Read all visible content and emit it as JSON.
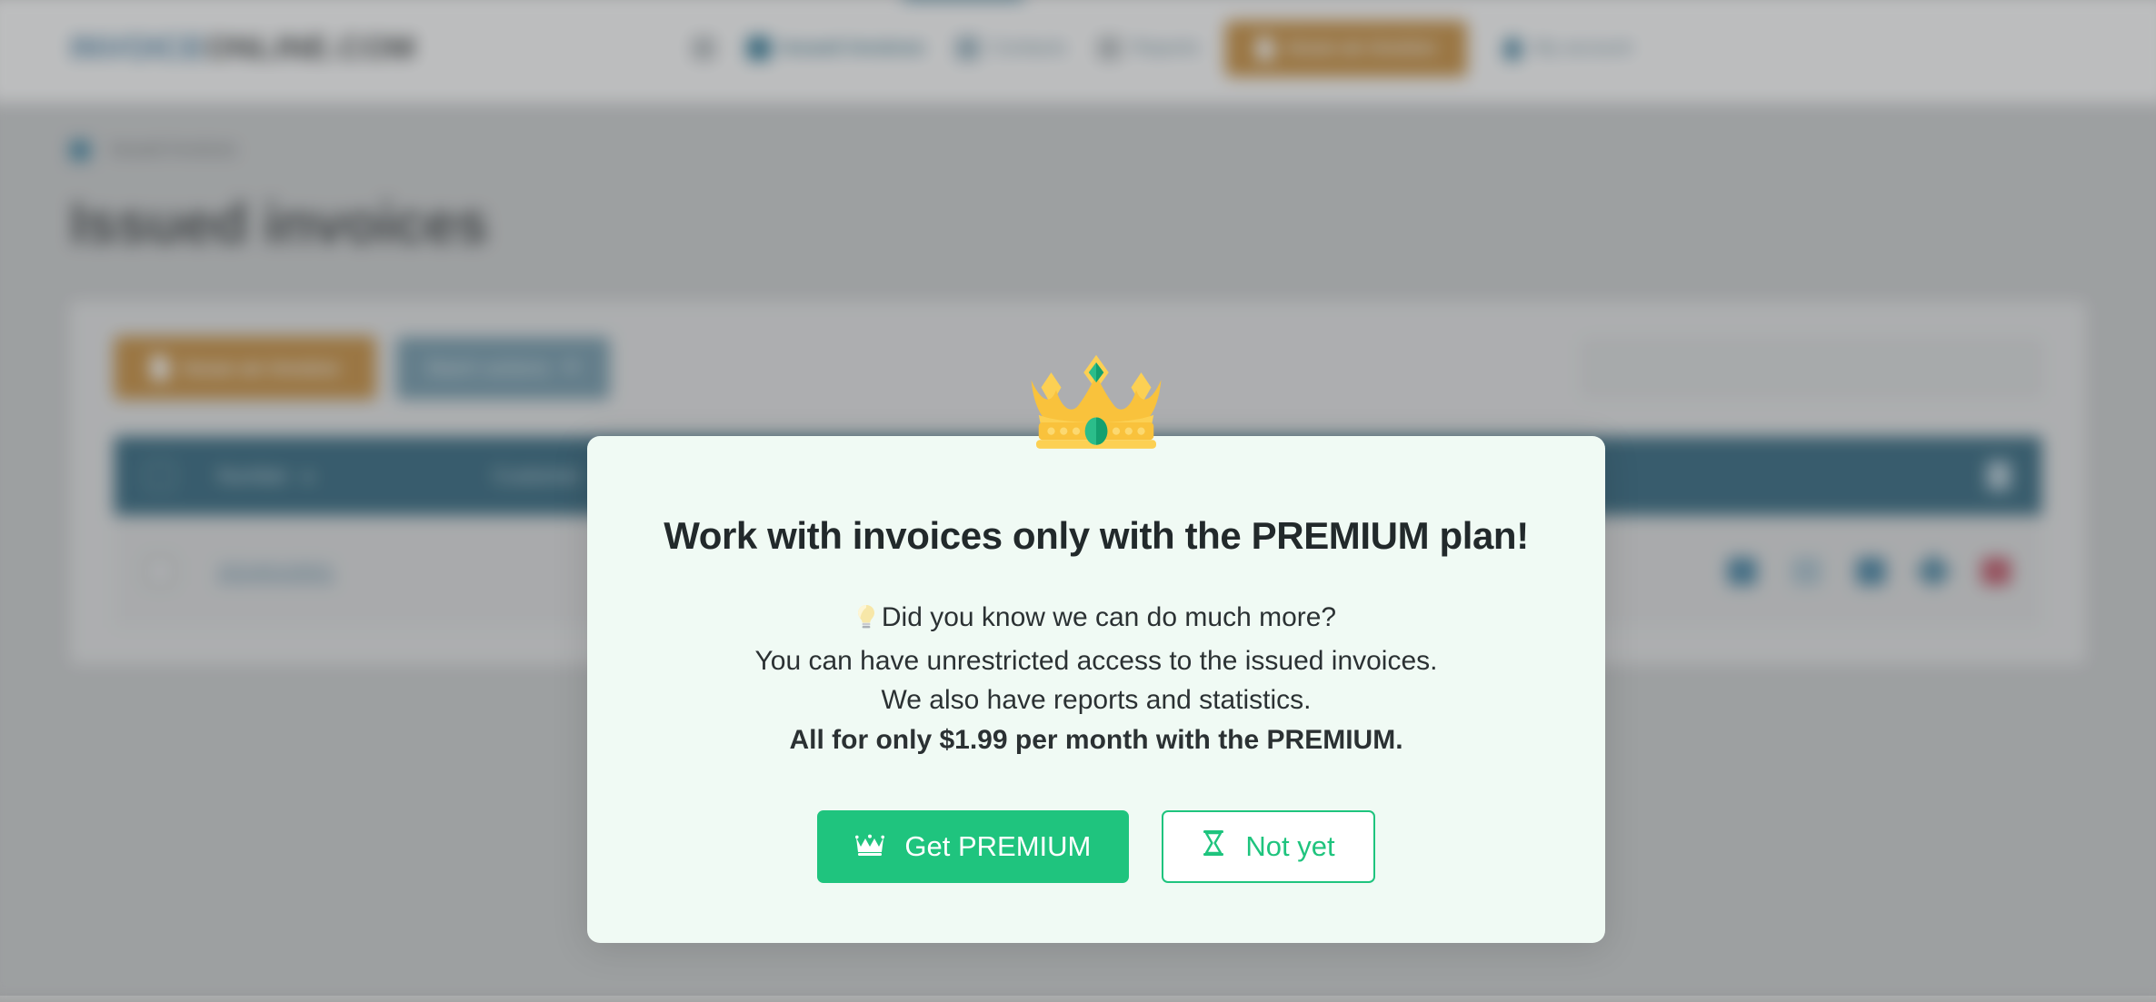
{
  "header": {
    "logo_part_a": "INVOICE",
    "logo_part_b": "ONLINE.COM",
    "nav": [
      {
        "label": "",
        "icon": "search-icon"
      },
      {
        "label": "Issued invoices",
        "icon": "invoice-icon"
      },
      {
        "label": "Contacts",
        "icon": "contacts-icon"
      },
      {
        "label": "Reports",
        "icon": "reports-icon"
      }
    ],
    "issue_button": "Issue an invoice",
    "account_label": "My account"
  },
  "breadcrumb": {
    "home_icon": "home-icon",
    "current": "Issued invoices"
  },
  "page": {
    "title": "Issued invoices"
  },
  "toolbar": {
    "issue_button": "Issue an invoice",
    "batch_button": "Batch actions",
    "search_placeholder": "",
    "search_value": ""
  },
  "table": {
    "columns": [
      "Number",
      "Customer"
    ],
    "rows": [
      {
        "number": "2024010001"
      }
    ],
    "row_action_icons": [
      "preview-icon",
      "download-icon",
      "copy-icon",
      "edit-icon",
      "delete-icon"
    ],
    "settings_icon": "columns-settings-icon"
  },
  "modal": {
    "crown_icon": "crown-icon",
    "title": "Work with invoices only with the PREMIUM plan!",
    "lines": [
      {
        "text": "Did you know we can do much more?",
        "bold": false,
        "bulb": true
      },
      {
        "text": "You can have unrestricted access to the issued invoices.",
        "bold": false,
        "bulb": false
      },
      {
        "text": "We also have reports and statistics.",
        "bold": false,
        "bulb": false
      },
      {
        "text": "All for only $1.99 per month with the PREMIUM.",
        "bold": true,
        "bulb": false
      }
    ],
    "primary_button": "Get PREMIUM",
    "secondary_button": "Not yet"
  },
  "colors": {
    "brand_blue": "#0d5a7c",
    "accent_orange": "#d4820f",
    "premium_green": "#1fc47e",
    "modal_bg": "#f0faf4",
    "crown_gold": "#f9c23c",
    "gem_green": "#2bbd8a",
    "delete_red": "#d63c55"
  }
}
